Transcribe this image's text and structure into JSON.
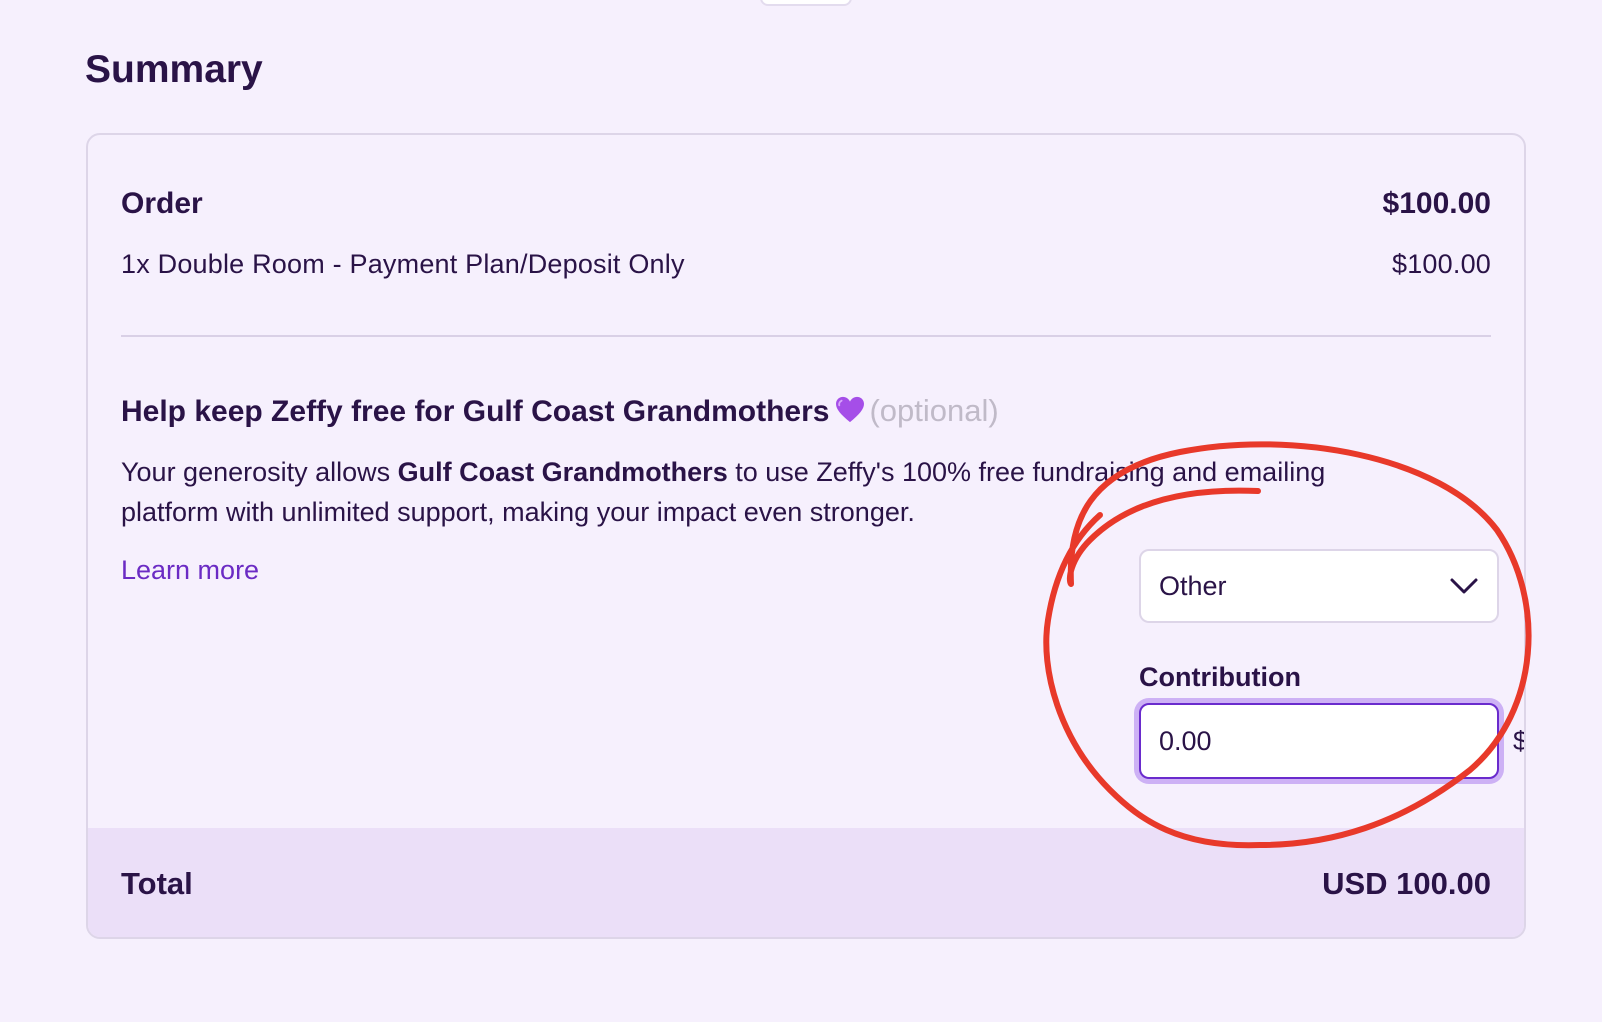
{
  "summary": {
    "title": "Summary"
  },
  "order": {
    "label": "Order",
    "total": "$100.00",
    "items": [
      {
        "description": "1x Double Room - Payment Plan/Deposit Only",
        "price": "$100.00"
      }
    ]
  },
  "tip": {
    "title": "Help keep Zeffy free for Gulf Coast Grandmothers",
    "heart_icon": "purple-heart-icon",
    "optional_label": "(optional)",
    "description_prefix": "Your generosity allows ",
    "organization": "Gulf Coast Grandmothers",
    "description_suffix": " to use Zeffy's 100% free fundraising and emailing platform with unlimited support, making your impact even stronger.",
    "learn_more": "Learn more",
    "select_value": "Other",
    "contribution_label": "Contribution",
    "contribution_value": "0.00",
    "currency_symbol": "$"
  },
  "total": {
    "label": "Total",
    "amount": "USD 100.00"
  },
  "colors": {
    "background": "#f6f0fd",
    "text": "#2a1347",
    "accent": "#6b2bc4",
    "total_bar": "#ebdff8",
    "annotation": "#e8392a"
  }
}
